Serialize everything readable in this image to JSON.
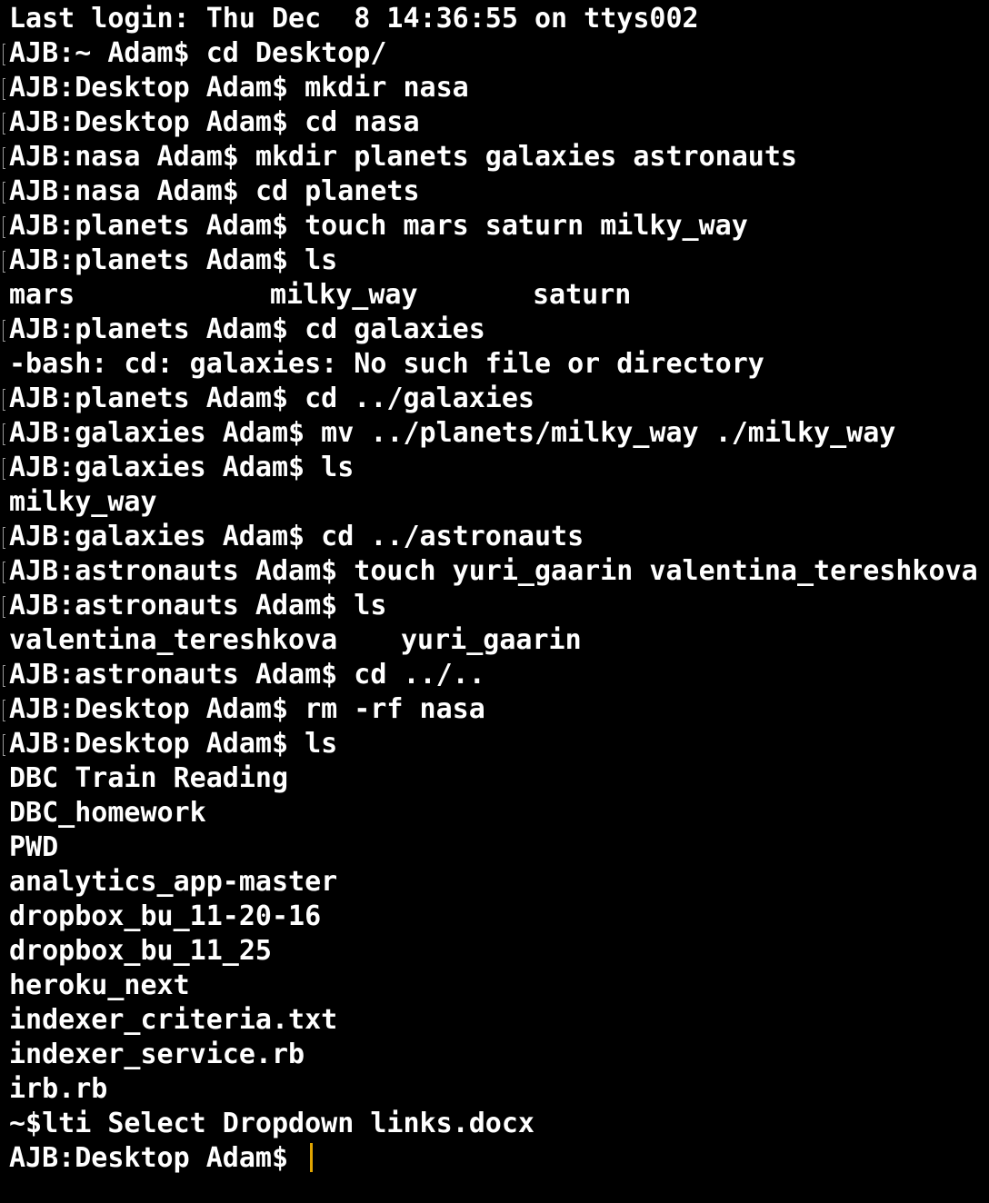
{
  "terminal": {
    "last_login": "Last login: Thu Dec  8 14:36:55 on ttys002",
    "lines": [
      {
        "prompt": "AJB:~ Adam$ ",
        "command": "cd Desktop/"
      },
      {
        "prompt": "AJB:Desktop Adam$ ",
        "command": "mkdir nasa"
      },
      {
        "prompt": "AJB:Desktop Adam$ ",
        "command": "cd nasa"
      },
      {
        "prompt": "AJB:nasa Adam$ ",
        "command": "mkdir planets galaxies astronauts"
      },
      {
        "prompt": "AJB:nasa Adam$ ",
        "command": "cd planets"
      },
      {
        "prompt": "AJB:planets Adam$ ",
        "command": "touch mars saturn milky_way"
      },
      {
        "prompt": "AJB:planets Adam$ ",
        "command": "ls"
      },
      {
        "prompt": "AJB:planets Adam$ ",
        "command": "cd galaxies"
      },
      {
        "prompt": "AJB:planets Adam$ ",
        "command": "cd ../galaxies"
      },
      {
        "prompt": "AJB:galaxies Adam$ ",
        "command": "mv ../planets/milky_way ./milky_way"
      },
      {
        "prompt": "AJB:galaxies Adam$ ",
        "command": "ls"
      },
      {
        "prompt": "AJB:galaxies Adam$ ",
        "command": "cd ../astronauts"
      },
      {
        "prompt": "AJB:astronauts Adam$ ",
        "command": "touch yuri_gaarin valentina_tereshkova"
      },
      {
        "prompt": "AJB:astronauts Adam$ ",
        "command": "ls"
      },
      {
        "prompt": "AJB:astronauts Adam$ ",
        "command": "cd ../.."
      },
      {
        "prompt": "AJB:Desktop Adam$ ",
        "command": "rm -rf nasa"
      },
      {
        "prompt": "AJB:Desktop Adam$ ",
        "command": "ls"
      }
    ],
    "outputs": {
      "planets_ls": [
        "mars",
        "milky_way",
        "saturn"
      ],
      "cd_error": "-bash: cd: galaxies: No such file or directory",
      "galaxies_ls": [
        "milky_way"
      ],
      "astronauts_ls": [
        "valentina_tereshkova",
        "yuri_gaarin"
      ],
      "desktop_ls": [
        "DBC Train Reading",
        "DBC_homework",
        "PWD",
        "analytics_app-master",
        "dropbox_bu_11-20-16",
        "dropbox_bu_11_25",
        "heroku_next",
        "indexer_criteria.txt",
        "indexer_service.rb",
        "irb.rb",
        "~$lti Select Dropdown links.docx"
      ]
    },
    "current_prompt": "AJB:Desktop Adam$ ",
    "cursor_color": "#e0a400",
    "background_color": "#000000",
    "text_color": "#ffffff"
  }
}
